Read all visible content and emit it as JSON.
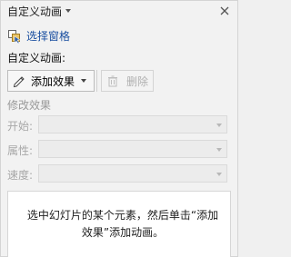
{
  "header": {
    "title": "自定义动画"
  },
  "select_pane": {
    "label": "选择窗格"
  },
  "custom_animation": {
    "section_label": "自定义动画:",
    "add_effect_label": "添加效果",
    "delete_label": "删除"
  },
  "modify_effect": {
    "group_title": "修改效果",
    "start_label": "开始:",
    "property_label": "属性:",
    "speed_label": "速度:",
    "start_value": "",
    "property_value": "",
    "speed_value": ""
  },
  "animation_list": {
    "hint": "选中幻灯片的某个元素，然后单击“添加效果”添加动画。"
  },
  "colors": {
    "link": "#1a4fa0",
    "disabled_text": "#a8a8a8",
    "panel_bg": "#f2f2f2"
  }
}
